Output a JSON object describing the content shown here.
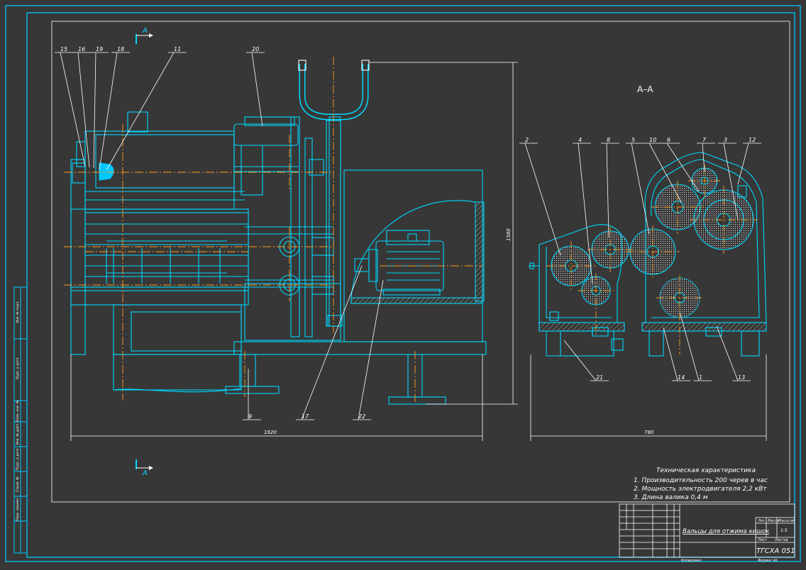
{
  "colors": {
    "background": "#373737",
    "frame": "#00c8ff",
    "line": "#00d8ff",
    "inner_frame": "#d8d8d8",
    "center_line": "#ff9a1e",
    "text": "#ffffff",
    "hatch": "#c8c8c8"
  },
  "section_marks": {
    "top": "A",
    "bottom": "A"
  },
  "section_title": "А–А",
  "part_labels_main": [
    "15",
    "16",
    "19",
    "18",
    "11",
    "20",
    "9",
    "17",
    "22"
  ],
  "part_labels_section": [
    "2",
    "4",
    "8",
    "5",
    "10",
    "6",
    "7",
    "3",
    "12",
    "21",
    "14",
    "1",
    "13"
  ],
  "dimensions": {
    "main_width": "1920",
    "main_height": "1580",
    "section_width": "780"
  },
  "tech_spec": {
    "title": "Техническая характеристика",
    "items": [
      "1. Производительность 200 черев в час",
      "2. Мощность электродвигателя 2,2 кВт",
      "3. Длина валика 0,4 м"
    ]
  },
  "title_block": {
    "name": "Вальцы для отжима кишок",
    "code": "ТГСХА 051",
    "header_cells": [
      "Лит.",
      "Масса",
      "Масштаб"
    ],
    "sheet_value": "1:5",
    "sheet_label": "Лист",
    "sheets_label": "Листов",
    "copied_label": "Копировал",
    "format_label": "Формат А1"
  },
  "side_stamp_labels": [
    "Инв. № подл.",
    "Подп. и дата",
    "Взам. инв. №",
    "Инв. № дубл.",
    "Подп. и дата",
    "Справ. №",
    "Перв. примен."
  ]
}
